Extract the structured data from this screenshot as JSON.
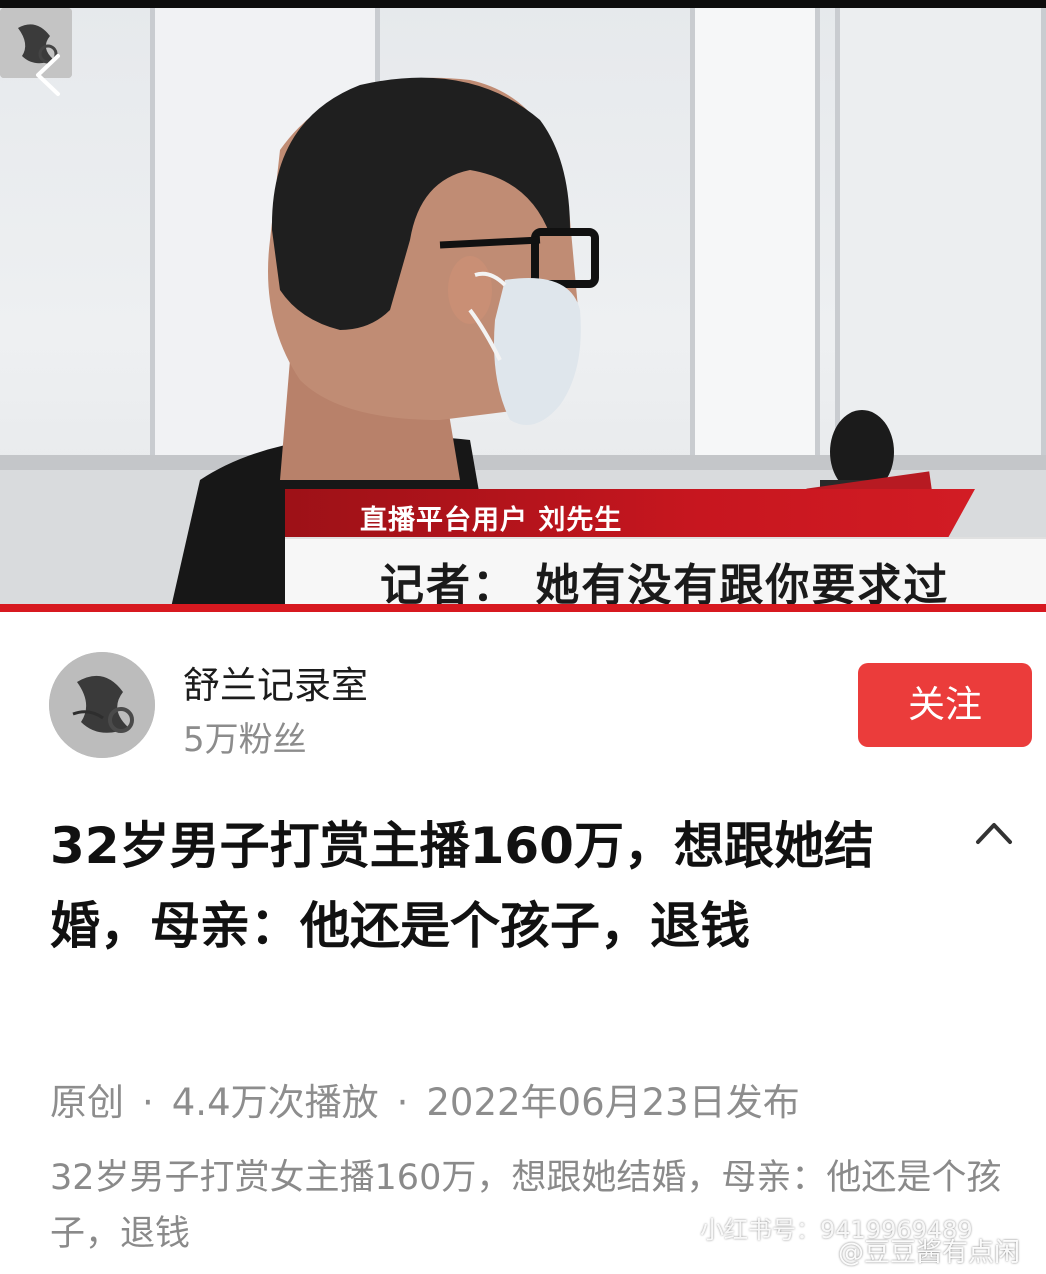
{
  "video": {
    "caption_name": "直播平台用户 刘先生",
    "caption_subtitle": "记者：  她有没有跟你要求过"
  },
  "author": {
    "name": "舒兰记录室",
    "fans": "5万粉丝",
    "follow_label": "关注"
  },
  "post": {
    "title": "32岁男子打赏主播160万，想跟她结婚，母亲：他还是个孩子，退钱",
    "meta": {
      "type": "原创",
      "plays": "4.4万次播放",
      "date": "2022年06月23日发布"
    },
    "description": "32岁男子打赏女主播160万，想跟她结婚，母亲：他还是个孩子，退钱"
  },
  "watermark": {
    "line1": "小红书号：9419969489",
    "line2": "@豆豆酱有点闲"
  },
  "icons": {
    "back": "chevron-left-icon",
    "collapse": "chevron-up-icon",
    "weibo": "weibo-icon"
  },
  "colors": {
    "follow_button": "#eb3c3b",
    "caption_red": "#c7161f"
  }
}
